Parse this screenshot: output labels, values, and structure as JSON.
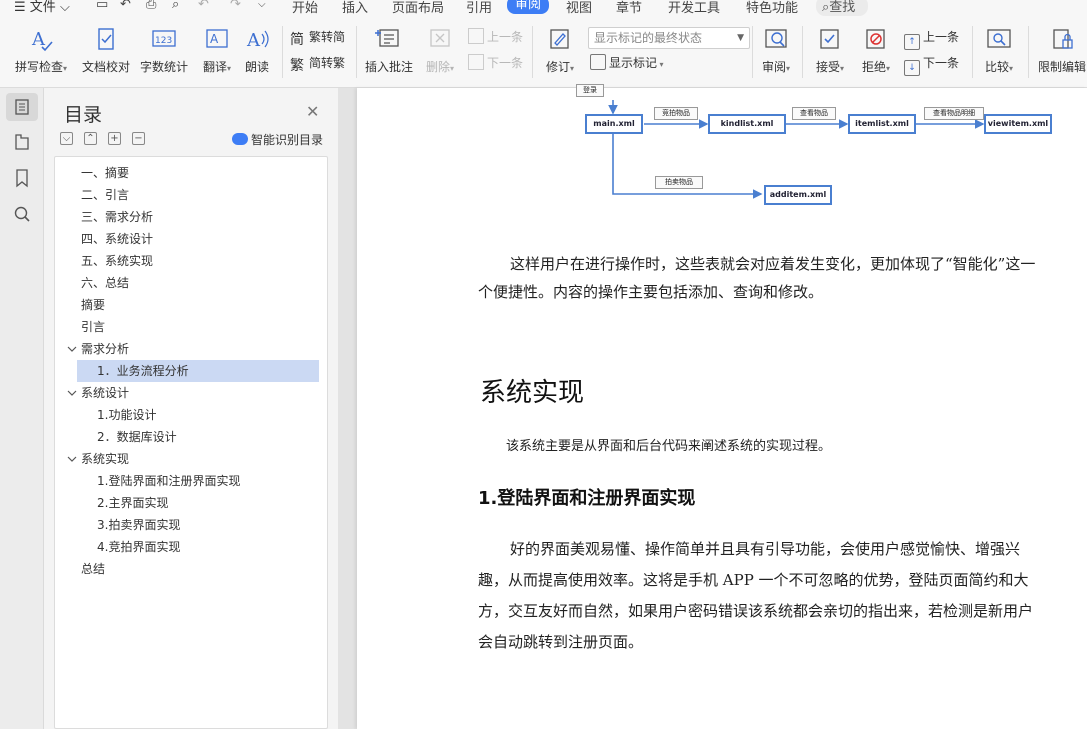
{
  "menubar": {
    "file_label": "文件",
    "tabs": [
      "开始",
      "插入",
      "页面布局",
      "引用",
      "审阅",
      "视图",
      "章节",
      "开发工具",
      "特色功能"
    ],
    "active_tab": "审阅",
    "search_label": "查找"
  },
  "ribbon": {
    "spell_check": "拼写检查",
    "doc_proof": "文档校对",
    "word_count": "字数统计",
    "translate": "翻译",
    "read_aloud": "朗读",
    "trad_to_simp": "繁转简",
    "simp_to_trad": "简转繁",
    "insert_comment": "插入批注",
    "delete": "删除",
    "prev_comment": "上一条",
    "next_comment": "下一条",
    "revise": "修订",
    "markup_state": "显示标记的最终状态",
    "show_markup": "显示标记",
    "review": "审阅",
    "accept": "接受",
    "reject": "拒绝",
    "prev_change": "上一条",
    "next_change": "下一条",
    "compare": "比较",
    "restrict_edit": "限制编辑"
  },
  "toc": {
    "title": "目录",
    "smart_label": "智能识别目录",
    "items": [
      {
        "label": "一、摘要",
        "level": 1
      },
      {
        "label": "二、引言",
        "level": 1
      },
      {
        "label": "三、需求分析",
        "level": 1
      },
      {
        "label": "四、系统设计",
        "level": 1
      },
      {
        "label": "五、系统实现",
        "level": 1
      },
      {
        "label": "六、总结",
        "level": 1
      },
      {
        "label": "摘要",
        "level": 1
      },
      {
        "label": "引言",
        "level": 1
      },
      {
        "label": "需求分析",
        "level": 1,
        "expanded": true
      },
      {
        "label": "1．业务流程分析",
        "level": 2,
        "selected": true
      },
      {
        "label": "系统设计",
        "level": 1,
        "expanded": true
      },
      {
        "label": "1.功能设计",
        "level": 2
      },
      {
        "label": "2．数据库设计",
        "level": 2
      },
      {
        "label": "系统实现",
        "level": 1,
        "expanded": true
      },
      {
        "label": "1.登陆界面和注册界面实现",
        "level": 2
      },
      {
        "label": "2.主界面实现",
        "level": 2
      },
      {
        "label": "3.拍卖界面实现",
        "level": 2
      },
      {
        "label": "4.竞拍界面实现",
        "level": 2
      },
      {
        "label": "总结",
        "level": 1
      }
    ]
  },
  "figure": {
    "login": "登录",
    "main": "main.xml",
    "kindlist": "kindlist.xml",
    "itemlist": "itemlist.xml",
    "viewitem": "viewitem.xml",
    "additem": "additem.xml",
    "edge_bid": "竞拍物品",
    "edge_view": "查看物品",
    "edge_detail": "查看物品明细",
    "edge_auction": "拍卖物品"
  },
  "document": {
    "para1": "这样用户在进行操作时，这些表就会对应着发生变化，更加体现了“智能化”这一个便捷性。内容的操作主要包括添加、查询和修改。",
    "heading1": "系统实现",
    "para2": "该系统主要是从界面和后台代码来阐述系统的实现过程。",
    "heading2": "1.登陆界面和注册界面实现",
    "para3": "好的界面美观易懂、操作简单并且具有引导功能，会使用户感觉愉快、增强兴趣，从而提高使用效率。这将是手机 APP 一个不可忽略的优势，登陆页面简约和大方，交互友好而自然，如果用户密码错误该系统都会亲切的指出来，若检测是新用户会自动跳转到注册页面。"
  }
}
